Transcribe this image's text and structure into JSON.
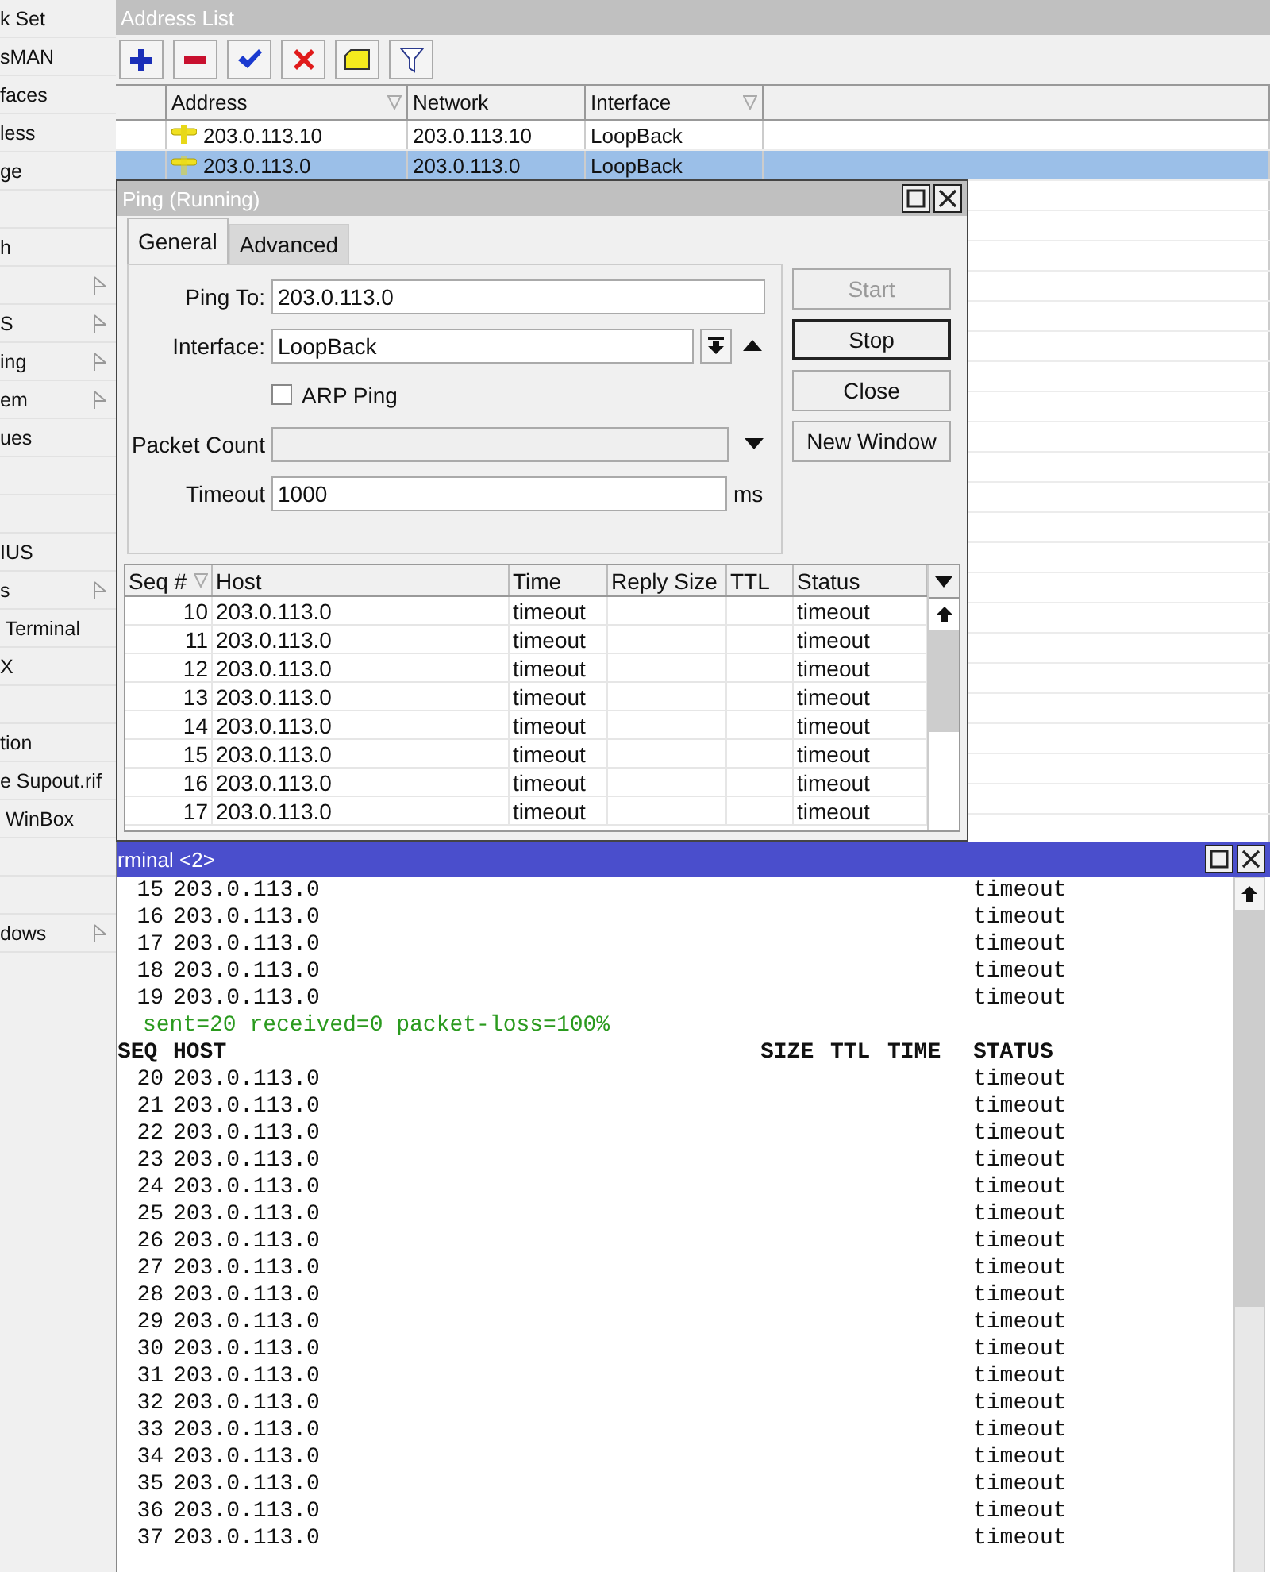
{
  "sidebar": {
    "items": [
      {
        "label": "k Set",
        "submenu": false
      },
      {
        "label": "sMAN",
        "submenu": false
      },
      {
        "label": "faces",
        "submenu": false
      },
      {
        "label": "less",
        "submenu": false
      },
      {
        "label": "ge",
        "submenu": false
      },
      {
        "submenu": false
      },
      {
        "label": "h",
        "submenu": false
      },
      {
        "submenu": true
      },
      {
        "label": "S",
        "submenu": true
      },
      {
        "label": "ing",
        "submenu": true
      },
      {
        "label": "em",
        "submenu": true
      },
      {
        "label": "ues",
        "submenu": false
      },
      {
        "submenu": false
      },
      {
        "submenu": false
      },
      {
        "label": "IUS",
        "submenu": false
      },
      {
        "label": "s",
        "submenu": true
      },
      {
        "label": " Terminal",
        "submenu": false
      },
      {
        "label": "X",
        "submenu": false
      },
      {
        "submenu": false
      },
      {
        "label": "tion",
        "submenu": false
      },
      {
        "label": "e Supout.rif",
        "submenu": false
      },
      {
        "label": " WinBox",
        "submenu": false
      },
      {
        "submenu": false
      },
      {
        "submenu": false
      },
      {
        "label": "dows",
        "submenu": true
      }
    ]
  },
  "address_list": {
    "title": "Address List",
    "toolbar": [
      {
        "kind": "add"
      },
      {
        "kind": "remove"
      },
      {
        "kind": "enable"
      },
      {
        "kind": "disable"
      },
      {
        "kind": "comment"
      },
      {
        "kind": "filter"
      }
    ],
    "columns": [
      {
        "label": "Address",
        "marker": true
      },
      {
        "label": "Network",
        "marker": false
      },
      {
        "label": "Interface",
        "marker": true
      }
    ],
    "rows": [
      {
        "address": "203.0.113.10",
        "network": "203.0.113.10",
        "interface": "LoopBack",
        "selected": false
      },
      {
        "address": "203.0.113.0",
        "network": "203.0.113.0",
        "interface": "LoopBack",
        "selected": true
      }
    ]
  },
  "ping": {
    "title": "Ping (Running)",
    "tabs": [
      {
        "label": "General",
        "selected": true
      },
      {
        "label": "Advanced",
        "selected": false
      }
    ],
    "fields": [
      {
        "kind": "text",
        "label": "Ping To:",
        "value": "203.0.113.0"
      },
      {
        "kind": "select",
        "label": "Interface:",
        "value": "LoopBack"
      },
      {
        "kind": "checkbox",
        "label": "ARP Ping",
        "checked": false
      },
      {
        "kind": "combo",
        "label": "Packet Count",
        "disabled": true
      },
      {
        "kind": "text",
        "label": "Timeout",
        "value": "1000",
        "unit": "ms"
      }
    ],
    "buttons": [
      {
        "label": "Start",
        "disabled": true,
        "default": false
      },
      {
        "label": "Stop",
        "disabled": false,
        "default": true
      },
      {
        "label": "Close",
        "disabled": false,
        "default": false
      },
      {
        "label": "New Window",
        "disabled": false,
        "default": false
      }
    ],
    "table": {
      "columns": [
        {
          "label": "Seq #",
          "sorted": true
        },
        {
          "label": "Host",
          "sorted": false
        },
        {
          "label": "Time",
          "sorted": false
        },
        {
          "label": "Reply Size",
          "sorted": false
        },
        {
          "label": "TTL",
          "sorted": false
        },
        {
          "label": "Status",
          "sorted": false
        }
      ],
      "rows": [
        {
          "seq": "10",
          "host": "203.0.113.0",
          "time": "timeout",
          "status": "timeout"
        },
        {
          "seq": "11",
          "host": "203.0.113.0",
          "time": "timeout",
          "status": "timeout"
        },
        {
          "seq": "12",
          "host": "203.0.113.0",
          "time": "timeout",
          "status": "timeout"
        },
        {
          "seq": "13",
          "host": "203.0.113.0",
          "time": "timeout",
          "status": "timeout"
        },
        {
          "seq": "14",
          "host": "203.0.113.0",
          "time": "timeout",
          "status": "timeout"
        },
        {
          "seq": "15",
          "host": "203.0.113.0",
          "time": "timeout",
          "status": "timeout"
        },
        {
          "seq": "16",
          "host": "203.0.113.0",
          "time": "timeout",
          "status": "timeout"
        },
        {
          "seq": "17",
          "host": "203.0.113.0",
          "time": "timeout",
          "status": "timeout"
        }
      ]
    }
  },
  "terminal": {
    "title": "rminal <2>",
    "lines": [
      {
        "kind": "row",
        "seq": "15",
        "host": "203.0.113.0",
        "status": "timeout"
      },
      {
        "kind": "row",
        "seq": "16",
        "host": "203.0.113.0",
        "status": "timeout"
      },
      {
        "kind": "row",
        "seq": "17",
        "host": "203.0.113.0",
        "status": "timeout"
      },
      {
        "kind": "row",
        "seq": "18",
        "host": "203.0.113.0",
        "status": "timeout"
      },
      {
        "kind": "row",
        "seq": "19",
        "host": "203.0.113.0",
        "status": "timeout"
      },
      {
        "kind": "summary",
        "text": "sent=20 received=0 packet-loss=100%"
      },
      {
        "kind": "header",
        "columns": [
          "SEQ",
          "HOST",
          "SIZE",
          "TTL",
          "TIME",
          "STATUS"
        ]
      },
      {
        "kind": "row",
        "seq": "20",
        "host": "203.0.113.0",
        "status": "timeout"
      },
      {
        "kind": "row",
        "seq": "21",
        "host": "203.0.113.0",
        "status": "timeout"
      },
      {
        "kind": "row",
        "seq": "22",
        "host": "203.0.113.0",
        "status": "timeout"
      },
      {
        "kind": "row",
        "seq": "23",
        "host": "203.0.113.0",
        "status": "timeout"
      },
      {
        "kind": "row",
        "seq": "24",
        "host": "203.0.113.0",
        "status": "timeout"
      },
      {
        "kind": "row",
        "seq": "25",
        "host": "203.0.113.0",
        "status": "timeout"
      },
      {
        "kind": "row",
        "seq": "26",
        "host": "203.0.113.0",
        "status": "timeout"
      },
      {
        "kind": "row",
        "seq": "27",
        "host": "203.0.113.0",
        "status": "timeout"
      },
      {
        "kind": "row",
        "seq": "28",
        "host": "203.0.113.0",
        "status": "timeout"
      },
      {
        "kind": "row",
        "seq": "29",
        "host": "203.0.113.0",
        "status": "timeout"
      },
      {
        "kind": "row",
        "seq": "30",
        "host": "203.0.113.0",
        "status": "timeout"
      },
      {
        "kind": "row",
        "seq": "31",
        "host": "203.0.113.0",
        "status": "timeout"
      },
      {
        "kind": "row",
        "seq": "32",
        "host": "203.0.113.0",
        "status": "timeout"
      },
      {
        "kind": "row",
        "seq": "33",
        "host": "203.0.113.0",
        "status": "timeout"
      },
      {
        "kind": "row",
        "seq": "34",
        "host": "203.0.113.0",
        "status": "timeout"
      },
      {
        "kind": "row",
        "seq": "35",
        "host": "203.0.113.0",
        "status": "timeout"
      },
      {
        "kind": "row",
        "seq": "36",
        "host": "203.0.113.0",
        "status": "timeout"
      },
      {
        "kind": "row",
        "seq": "37",
        "host": "203.0.113.0",
        "status": "timeout"
      }
    ]
  }
}
